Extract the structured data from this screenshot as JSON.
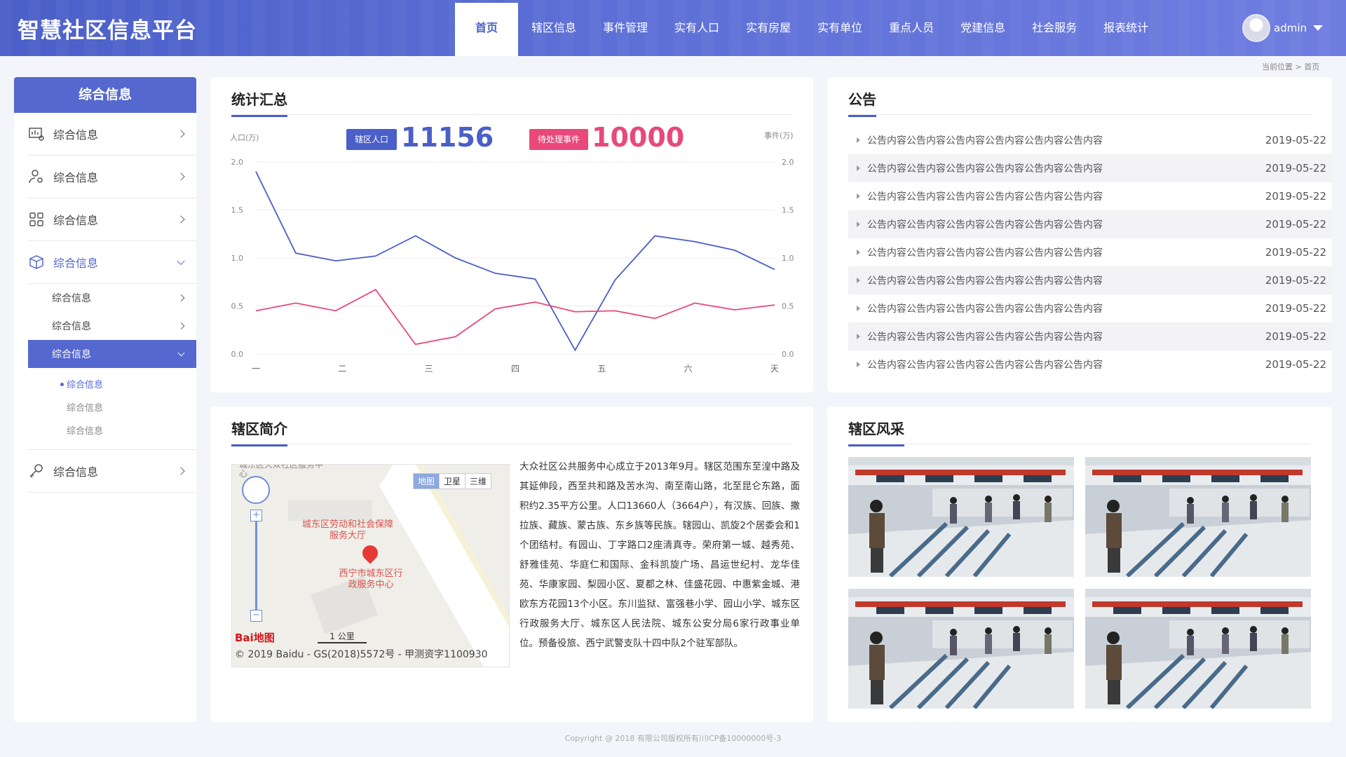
{
  "header": {
    "title": "智慧社区信息平台",
    "nav": [
      "首页",
      "辖区信息",
      "事件管理",
      "实有人口",
      "实有房屋",
      "实有单位",
      "重点人员",
      "党建信息",
      "社会服务",
      "报表统计"
    ],
    "active_index": 0,
    "user_name": "admin"
  },
  "breadcrumb": "当前位置 > 首页",
  "sidebar": {
    "title": "综合信息",
    "items": [
      {
        "label": "综合信息",
        "icon": "monitor-settings-icon"
      },
      {
        "label": "综合信息",
        "icon": "user-settings-icon"
      },
      {
        "label": "综合信息",
        "icon": "grid-icon"
      },
      {
        "label": "综合信息",
        "icon": "box-icon"
      }
    ],
    "sub_items": [
      "综合信息",
      "综合信息",
      "综合信息"
    ],
    "leaf_items": [
      "综合信息",
      "综合信息",
      "综合信息"
    ],
    "last_item": {
      "label": "综合信息",
      "icon": "key-icon"
    }
  },
  "stats": {
    "title": "统计汇总",
    "population_label": "辖区人口",
    "population_value": "11156",
    "events_label": "待处理事件",
    "events_value": "10000",
    "left_unit": "人口(万)",
    "right_unit": "事件(万)"
  },
  "chart_data": {
    "type": "line",
    "categories": [
      "一",
      "",
      "二",
      "",
      "三",
      "",
      "四",
      "",
      "五",
      "",
      "六",
      "",
      "天"
    ],
    "y_ticks": [
      "0.0",
      "0.5",
      "1.0",
      "1.5",
      "2.0"
    ],
    "ylim": [
      0,
      2.0
    ],
    "series": [
      {
        "color": "#4a5fc8",
        "values": [
          1.9,
          1.05,
          0.97,
          1.02,
          1.23,
          1.0,
          0.84,
          0.78,
          0.04,
          0.77,
          1.23,
          1.17,
          1.08,
          0.88
        ]
      },
      {
        "color": "#e8497a",
        "values": [
          0.45,
          0.53,
          0.45,
          0.67,
          0.1,
          0.18,
          0.47,
          0.54,
          0.44,
          0.45,
          0.37,
          0.53,
          0.46,
          0.51
        ]
      }
    ],
    "grid": true
  },
  "notice": {
    "title": "公告",
    "rows": [
      {
        "text": "公告内容公告内容公告内容公告内容公告内容公告内容",
        "date": "2019-05-22"
      },
      {
        "text": "公告内容公告内容公告内容公告内容公告内容公告内容",
        "date": "2019-05-22"
      },
      {
        "text": "公告内容公告内容公告内容公告内容公告内容公告内容",
        "date": "2019-05-22"
      },
      {
        "text": "公告内容公告内容公告内容公告内容公告内容公告内容",
        "date": "2019-05-22"
      },
      {
        "text": "公告内容公告内容公告内容公告内容公告内容公告内容",
        "date": "2019-05-22"
      },
      {
        "text": "公告内容公告内容公告内容公告内容公告内容公告内容",
        "date": "2019-05-22"
      },
      {
        "text": "公告内容公告内容公告内容公告内容公告内容公告内容",
        "date": "2019-05-22"
      },
      {
        "text": "公告内容公告内容公告内容公告内容公告内容公告内容",
        "date": "2019-05-22"
      },
      {
        "text": "公告内容公告内容公告内容公告内容公告内容公告内容",
        "date": "2019-05-22"
      }
    ]
  },
  "intro": {
    "title": "辖区简介",
    "text": "大众社区公共服务中心成立于2013年9月。辖区范围东至湟中路及其延伸段，西至共和路及苦水沟、南至南山路，北至昆仑东路，面积约2.35平方公里。人口13660人（3664户），有汉族、回族、撒拉族、藏族、蒙古族、东乡族等民族。辖园山、凯旋2个居委会和1个团结村。有园山、丁字路口2座清真寺。荣府第一城、越秀苑、舒雅佳苑、华庭仁和国际、金科凯旋广场、昌运世纪村、龙华佳苑、华康家园、梨园小区、夏都之林、佳盛花园、中惠紫金城、港欧东方花园13个小区。东川监狱、富强巷小学、园山小学、城东区行政服务大厅、城东区人民法院、城东公安分局6家行政事业单位。预备役旅、西宁武警支队十四中队2个驻军部队。"
  },
  "map": {
    "type_buttons": [
      "地图",
      "卫星",
      "三维"
    ],
    "poi_1": "城东区劳动和社会保障服务大厅",
    "poi_2": "西宁市城东区行政服务中心",
    "top_label": "城东区大众社区服务中心",
    "scale": "1 公里",
    "logo": "Bai地图",
    "copyright": "© 2019 Baidu - GS(2018)5572号 - 甲测资字1100930"
  },
  "gallery": {
    "title": "辖区风采"
  },
  "footer": "Copyright @ 2018 有限公司版权所有川ICP备10000000号-3"
}
